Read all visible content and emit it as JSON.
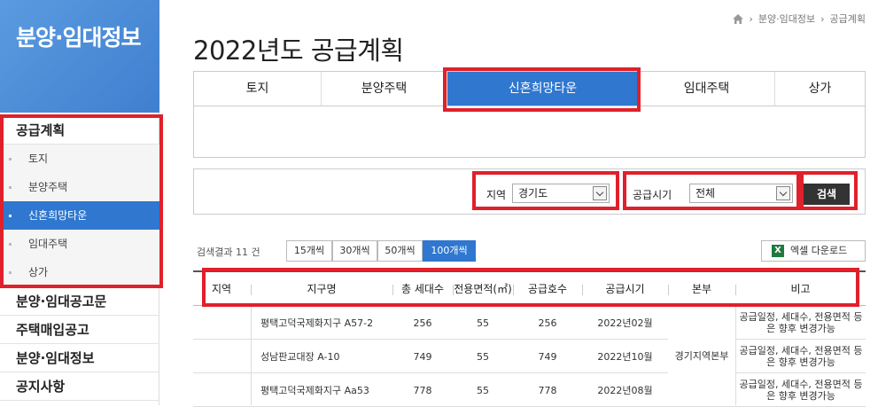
{
  "sidebar": {
    "title": "분양·임대정보",
    "section": "공급계획",
    "sub_items": [
      "토지",
      "분양주택",
      "신혼희망타운",
      "임대주택",
      "상가"
    ],
    "active_sub": "신혼희망타운",
    "main_items": [
      "분양·임대공고문",
      "주택매입공고",
      "분양·임대정보",
      "공지사항"
    ]
  },
  "breadcrumb": [
    "분양·임대정보",
    "공급계획"
  ],
  "page_title": "2022년도 공급계획",
  "tabs": [
    "토지",
    "분양주택",
    "신혼희망타운",
    "임대주택",
    "상가"
  ],
  "active_tab": "신혼희망타운",
  "search": {
    "region_label": "지역",
    "region_value": "경기도",
    "period_label": "공급시기",
    "period_value": "전체",
    "button": "검색"
  },
  "results": {
    "count_text": "검색결과 11 건",
    "page_sizes": [
      "15개씩",
      "30개씩",
      "50개씩",
      "100개씩"
    ],
    "active_page_size": "100개씩",
    "excel_label": "엑셀 다운로드"
  },
  "table": {
    "headers": [
      "지역",
      "지구명",
      "총 세대수",
      "전용면적(㎡)",
      "공급호수",
      "공급시기",
      "본부",
      "비고"
    ],
    "rows": [
      {
        "region": "",
        "district": "평택고덕국제화지구 A57-2",
        "households": "256",
        "area": "55",
        "supply": "256",
        "period": "2022년02월",
        "note": "공급일정, 세대수, 전용면적 등은 향후 변경가능"
      },
      {
        "region": "",
        "district": "성남판교대장 A-10",
        "households": "749",
        "area": "55",
        "supply": "749",
        "period": "2022년10월",
        "note": "공급일정, 세대수, 전용면적 등은 향후 변경가능"
      },
      {
        "region": "",
        "district": "평택고덕국제화지구 Aa53",
        "households": "778",
        "area": "55",
        "supply": "778",
        "period": "2022년08월",
        "note": "공급일정, 세대수, 전용면적 등은 향후 변경가능"
      }
    ],
    "merged_hq": "경기지역본부"
  },
  "colors": {
    "accent": "#2f77cf",
    "highlight": "#e0202b"
  }
}
